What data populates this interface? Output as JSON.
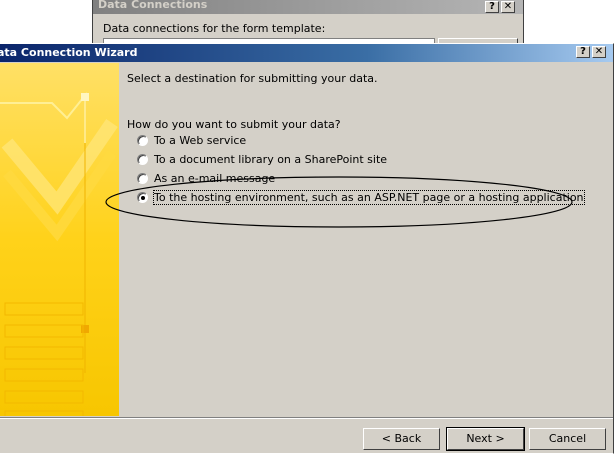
{
  "background_window": {
    "title": "Data Connections",
    "label": "Data connections for the form template:"
  },
  "wizard": {
    "title": "ata Connection Wizard",
    "heading": "Select a destination for submitting your data.",
    "question": "How do you want to submit your data?",
    "options": [
      {
        "label": "To a Web service",
        "selected": false
      },
      {
        "label": "To a document library on a SharePoint site",
        "selected": false
      },
      {
        "label": "As an e-mail message",
        "selected": false
      },
      {
        "label": "To the hosting environment, such as an ASP.NET page or a hosting application",
        "selected": true
      }
    ],
    "buttons": {
      "back": "< Back",
      "next": "Next >",
      "cancel": "Cancel"
    },
    "title_buttons": {
      "help": "?",
      "close": "✕"
    }
  },
  "colors": {
    "title_active": "#0a246a",
    "title_inactive": "#808080",
    "side_panel": "#ffd21a",
    "face": "#d4d0c8"
  }
}
